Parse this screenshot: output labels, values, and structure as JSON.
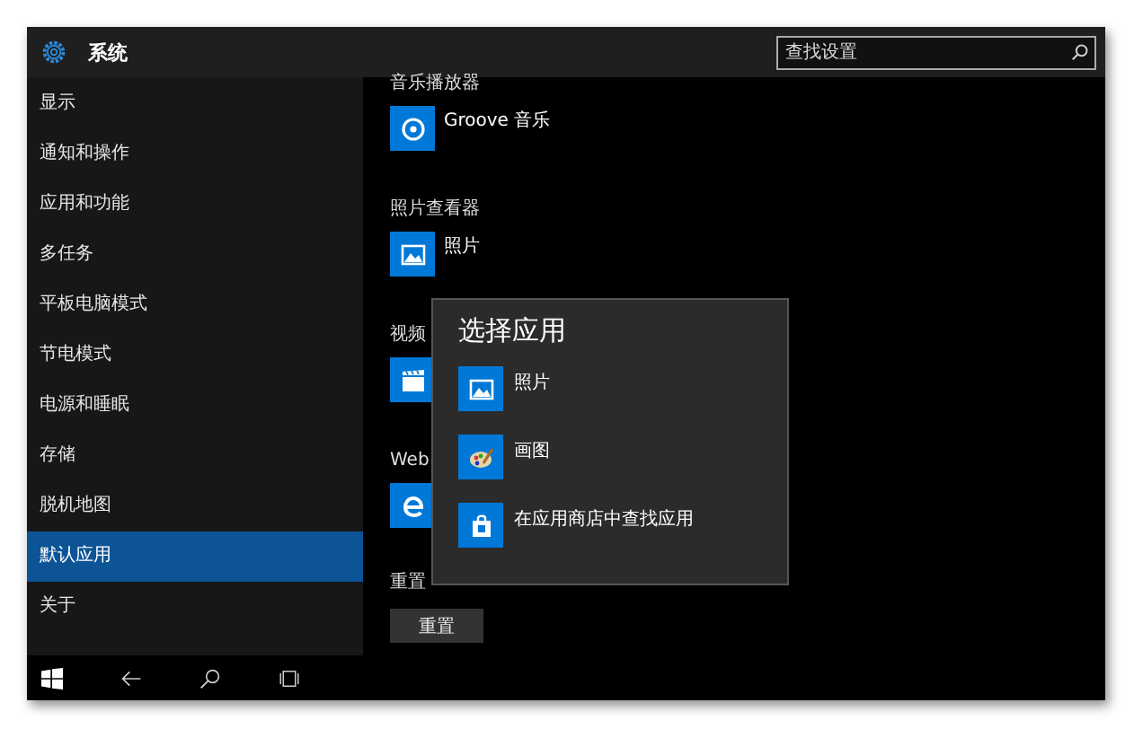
{
  "window": {
    "title": "系统"
  },
  "search": {
    "placeholder": "查找设置"
  },
  "sidebar": {
    "items": [
      {
        "label": "显示",
        "selected": false
      },
      {
        "label": "通知和操作",
        "selected": false
      },
      {
        "label": "应用和功能",
        "selected": false
      },
      {
        "label": "多任务",
        "selected": false
      },
      {
        "label": "平板电脑模式",
        "selected": false
      },
      {
        "label": "节电模式",
        "selected": false
      },
      {
        "label": "电源和睡眠",
        "selected": false
      },
      {
        "label": "存储",
        "selected": false
      },
      {
        "label": "脱机地图",
        "selected": false
      },
      {
        "label": "默认应用",
        "selected": true
      },
      {
        "label": "关于",
        "selected": false
      }
    ]
  },
  "content": {
    "sections": [
      {
        "heading": "音乐播放器",
        "app": {
          "kind": "music",
          "name": "Groove 音乐"
        }
      },
      {
        "heading": "照片查看器",
        "app": {
          "kind": "photo",
          "name": "照片"
        }
      },
      {
        "heading": "视频",
        "app": {
          "kind": "video"
        }
      },
      {
        "heading": "Web",
        "app": {
          "kind": "edge"
        }
      }
    ],
    "reset": {
      "heading": "重置",
      "button": "重置"
    }
  },
  "popup": {
    "title": "选择应用",
    "items": [
      {
        "kind": "photo",
        "name": "照片"
      },
      {
        "kind": "paint",
        "name": "画图"
      },
      {
        "kind": "store",
        "name": "在应用商店中查找应用"
      }
    ]
  }
}
